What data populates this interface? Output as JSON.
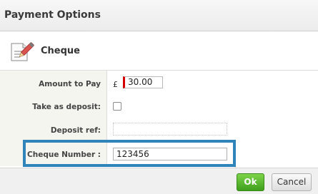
{
  "dialog": {
    "title": "Payment Options"
  },
  "section": {
    "label": "Cheque",
    "icon": "cheque-document-pen-icon"
  },
  "form": {
    "amount": {
      "label": "Amount to Pay",
      "currency": "£",
      "value": "30.00"
    },
    "deposit": {
      "label": "Take as deposit:",
      "checked": false
    },
    "deposit_ref": {
      "label": "Deposit ref:",
      "value": ""
    },
    "cheque_number": {
      "label": "Cheque Number :",
      "value": "123456"
    }
  },
  "buttons": {
    "ok": "Ok",
    "cancel": "Cancel"
  },
  "colors": {
    "highlight": "#2f84b9",
    "ok_green": "#4caf25",
    "required_marker": "#d60000",
    "label_bg": "#f3f5ee"
  }
}
